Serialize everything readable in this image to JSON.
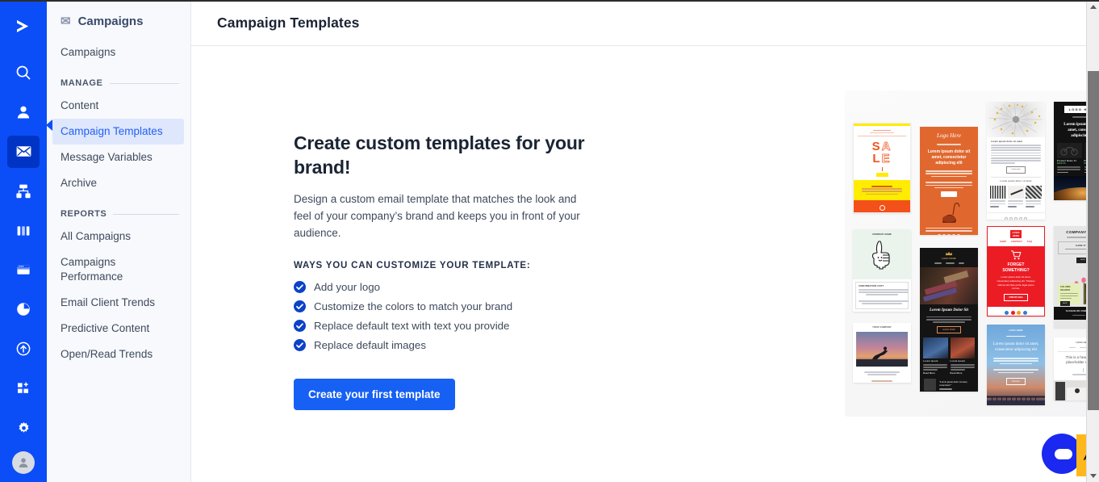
{
  "window": {
    "rail_icons": [
      {
        "name": "logo-chevron-icon",
        "label": "Logo"
      },
      {
        "name": "search-icon",
        "label": "Search"
      },
      {
        "name": "person-icon",
        "label": "Contacts"
      },
      {
        "name": "envelope-icon",
        "label": "Campaigns"
      },
      {
        "name": "sitemap-icon",
        "label": "Journeys"
      },
      {
        "name": "columns-icon",
        "label": "Boards"
      },
      {
        "name": "browser-window-icon",
        "label": "Pages"
      },
      {
        "name": "pie-chart-icon",
        "label": "Analytics"
      },
      {
        "name": "arrow-up-circle-icon",
        "label": "Publish"
      },
      {
        "name": "apps-grid-plus-icon",
        "label": "Apps"
      },
      {
        "name": "gear-icon",
        "label": "Settings"
      },
      {
        "name": "avatar-icon",
        "label": "Account"
      }
    ],
    "active_rail_icon": "envelope-icon"
  },
  "subnav": {
    "title": "Campaigns",
    "title_icon": "envelope-icon",
    "top_link": "Campaigns",
    "sections": [
      {
        "label": "MANAGE",
        "items": [
          {
            "label": "Content",
            "selected": false
          },
          {
            "label": "Campaign Templates",
            "selected": true
          },
          {
            "label": "Message Variables",
            "selected": false
          },
          {
            "label": "Archive",
            "selected": false
          }
        ]
      },
      {
        "label": "REPORTS",
        "items": [
          {
            "label": "All Campaigns",
            "selected": false
          },
          {
            "label": "Campaigns Performance",
            "selected": false
          },
          {
            "label": "Email Client Trends",
            "selected": false
          },
          {
            "label": "Predictive Content",
            "selected": false
          },
          {
            "label": "Open/Read Trends",
            "selected": false
          }
        ]
      }
    ]
  },
  "header": {
    "title": "Campaign Templates"
  },
  "empty_state": {
    "heading": "Create custom templates for your brand!",
    "description": "Design a custom email template that matches the look and feel of your company’s brand and keeps you in front of your audience.",
    "ways_label": "WAYS YOU CAN CUSTOMIZE YOUR TEMPLATE:",
    "ways": [
      "Add your logo",
      "Customize the colors to match your brand",
      "Replace default text with text you provide",
      "Replace default images"
    ],
    "cta_label": "Create your first template",
    "check_icon": "check-circle-icon"
  },
  "gallery": {
    "name": "template-gallery-illustration",
    "templates": [
      {
        "id": "sale",
        "title": "SALE",
        "accent": "#f0541f",
        "secondary": "#ffec00"
      },
      {
        "id": "logo-here-orange",
        "title": "Logo Here",
        "body": "Lorem ipsum dolor sit amet, consectetur adipiscing elit",
        "accent": "#e0682f"
      },
      {
        "id": "dandelion-news",
        "title": "Lorem ipsum dolor sit amet",
        "accent": "#ffffff"
      },
      {
        "id": "logo-here-dark",
        "title": "LOGO HERE",
        "body": "Lorem ipsum dolor sit amet, consectetur adipiscing elit",
        "accent": "#111111"
      },
      {
        "id": "company-name-thumb",
        "title": "COMPANY NAME",
        "subtitle": "CONFIRMATION COPY",
        "banner": "SLOGAN OR COMPANY NAME",
        "accent": "#5b21e0"
      },
      {
        "id": "dark-gallery",
        "title": "Lorem Ipsum Dolor Sit",
        "button": "LEARN MORE",
        "accent": "#141414"
      },
      {
        "id": "forget-something",
        "title": "FORGET SOMETHING?",
        "body": "Lorem ipsum dolor sit amet, consectetur adipiscing elit. Tristique ultrices elit vitae porta. Eget purus cursus.",
        "button": "FIND MY BAG",
        "accent": "#ec1c24"
      },
      {
        "id": "company-name-flowers",
        "title": "COMPANY NAME",
        "banner": "SLOGAN OR COMPANY NAME",
        "accent": "#e6e6e6"
      },
      {
        "id": "yoga-sunset",
        "title": "YOUR COMPANY",
        "accent": "#ffffff"
      },
      {
        "id": "blue-pier",
        "title": "Lorem ipsum dolor sit amet, consectetur adipiscing elit",
        "accent": "#5b9bd5"
      },
      {
        "id": "headline-placeholder",
        "title": "This is a headline and placeholder message",
        "accent": "#ffffff"
      }
    ]
  },
  "chat_widget": {
    "name": "chat-launcher",
    "color": "#1a28f0",
    "tab_color": "#ffb81c",
    "tab_icon": "mountain-icon"
  },
  "scrollbar": {
    "name": "vertical-scrollbar",
    "up_icon": "triangle-up-icon",
    "down_icon": "triangle-down-icon"
  }
}
